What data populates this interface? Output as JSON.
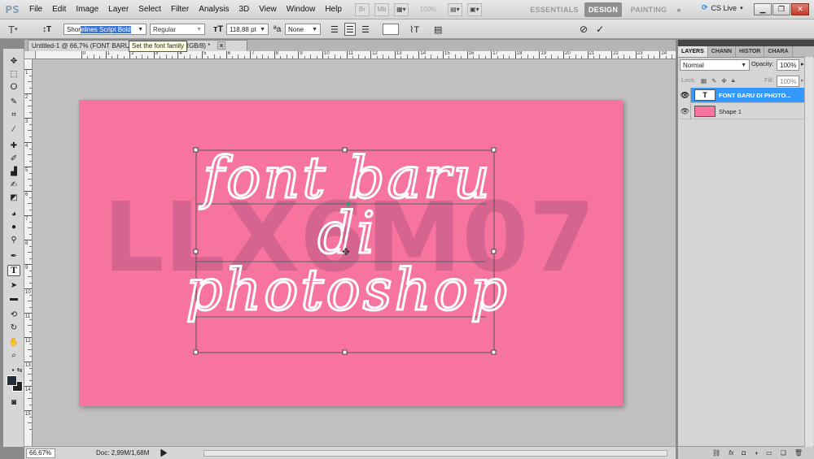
{
  "app": {
    "logo": "PS",
    "menu": [
      "File",
      "Edit",
      "Image",
      "Layer",
      "Select",
      "Filter",
      "Analysis",
      "3D",
      "View",
      "Window",
      "Help"
    ],
    "zoom_display": "100%",
    "workspaces": [
      "ESSENTIALS",
      "DESIGN",
      "PAINTING",
      "»"
    ],
    "cs_live": "CS Live"
  },
  "options": {
    "font_family_prefix": "Shor",
    "font_family_selected": "elines Script Bold",
    "font_style": "Regular",
    "font_size": "118,88 pt",
    "anti_alias": "None",
    "tooltip": "Set the font family"
  },
  "document": {
    "tab_title": "Untitled-1 @ 66,7% (FONT BARU DI PHOTOSHOP, RGB/8) *",
    "zoom": "66,67%",
    "doc_info": "Doc: 2,99M/1,68M"
  },
  "canvas": {
    "bg_color": "#f7749f",
    "watermark": "LLX6M07",
    "lines": [
      "font baru",
      "di",
      "photoshop"
    ]
  },
  "layers_panel": {
    "tabs": [
      "LAYERS",
      "CHANN",
      "HISTOR",
      "CHARA"
    ],
    "blend_mode": "Normal",
    "opacity_label": "Opacity:",
    "opacity": "100%",
    "lock_label": "Lock:",
    "fill_label": "Fill:",
    "fill": "100%",
    "layers": [
      {
        "name": "FONT BARU DI PHOTO...",
        "thumb": "T",
        "selected": true
      },
      {
        "name": "Shape 1",
        "thumb": "",
        "selected": false
      }
    ]
  },
  "ruler_h": [
    "0",
    "1",
    "2",
    "3",
    "4",
    "5",
    "6",
    "7",
    "8",
    "9",
    "10",
    "11",
    "12",
    "13",
    "14",
    "15",
    "16",
    "17",
    "18",
    "19",
    "20",
    "21",
    "22",
    "23",
    "24",
    "25",
    "26"
  ],
  "ruler_v": [
    "1",
    "2",
    "3",
    "4",
    "5",
    "6",
    "7",
    "8",
    "9",
    "10",
    "11",
    "12",
    "13",
    "14",
    "15"
  ],
  "colors": {
    "foreground": "#242d3c",
    "background": "#222222",
    "selection": "#3399ff"
  }
}
